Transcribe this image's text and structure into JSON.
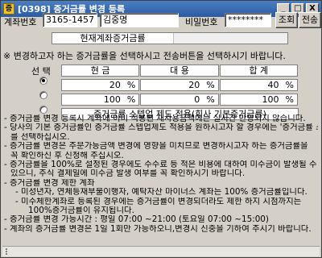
{
  "window": {
    "title": "[0398] 증거금률 변경 등록",
    "app_badge": "증",
    "minimize_label": "_",
    "maximize_label": "□",
    "close_label": "X"
  },
  "account": {
    "account_label": "계좌번호",
    "account_number": "3165-1457",
    "account_name": "김중명",
    "password_label": "비밀번호",
    "password_mask": "********",
    "query_button": "조회",
    "submit_button": "전송"
  },
  "current_rate_label": "현재계좌증거금률",
  "instruction": "※ 변경하고자 하는 증거금률을 선택하시고 전송버튼을 선택하시기 바랍니다.",
  "table": {
    "select_label": "선 택",
    "headers": [
      "현 금",
      "대 용",
      "합 계"
    ],
    "rows": [
      {
        "selected": true,
        "cash": "20",
        "substitute": "20",
        "total": "40",
        "unit": "%"
      },
      {
        "selected": false,
        "cash": "100",
        "substitute": "0",
        "total": "100",
        "unit": "%"
      }
    ],
    "stepped_label": "증거금률 스텝업 제도 적용(회사 기본증거금률)"
  },
  "notes": [
    "- 증거금률 변경 등록시 계좌에 이미 적용된 재사용금액에는 실시간 반영되지 않습니다.",
    "- 당사의 기본 증거금률인 증거금률 스텝업제도 적용을 원하시고자 할 경우에는 '증거금률 스텝업제도'",
    "  를 선택하십시오.",
    "- 증거금률 변경은 주문가능금액 변경에 영향을 미치므로 변경하시고자 하는 증거금률을",
    "  꼭 확인하신 후 신청해 주십시오.",
    "- 증거금률을 100%로 설정된 경우에도 수수료 등 적은 비용에 대하여 미수금이 발생될 수",
    "  있으니, 주식 결제일에 미수금 발생 여부를 꼭 확인하시기 바랍니다.",
    "- 증거금률 변경 제한 계좌",
    "  - 미성년자, 연체등재부불이행자, 예탁자산 마이너스 계좌는 100% 증거금률입니다.",
    "  - 미수체한계좌로 등록된 경우에는 증거금률이 변경되더라도 제한 하지 시점까지는",
    "    100%증거금률이 유지됩니다.",
    "- 증거금률 변경 가능시간 : 평일 07:00 ~21:00 (토요일 07:00 ~15:00)",
    "- 계좌의 증거금률 변경은 1일 1회만 가능하오니,변경시 신중을 기하여 주시기 바랍니다."
  ]
}
